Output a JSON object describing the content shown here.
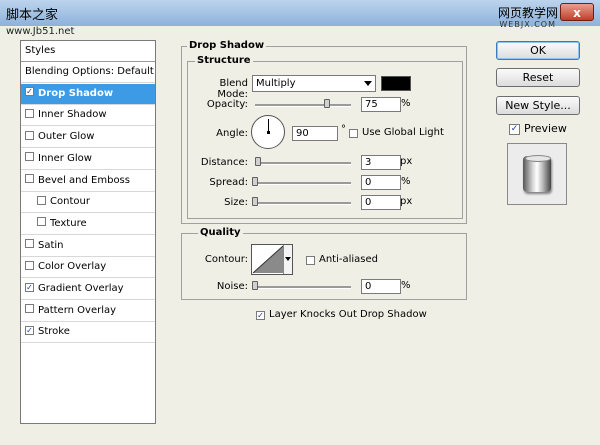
{
  "titlebar": {
    "wm_left": "脚本之家",
    "wm_left2": "www.Jb51.net",
    "wm_right": "网页教学网",
    "wm_right2": "WEBJX.COM",
    "close_label": "x"
  },
  "styles_list": {
    "header": "Styles",
    "items": [
      {
        "label": "Blending Options: Default",
        "checkbox": false,
        "checked": false,
        "selected": false,
        "indent": false
      },
      {
        "label": "Drop Shadow",
        "checkbox": true,
        "checked": true,
        "selected": true,
        "indent": false
      },
      {
        "label": "Inner Shadow",
        "checkbox": true,
        "checked": false,
        "selected": false,
        "indent": false
      },
      {
        "label": "Outer Glow",
        "checkbox": true,
        "checked": false,
        "selected": false,
        "indent": false
      },
      {
        "label": "Inner Glow",
        "checkbox": true,
        "checked": false,
        "selected": false,
        "indent": false
      },
      {
        "label": "Bevel and Emboss",
        "checkbox": true,
        "checked": false,
        "selected": false,
        "indent": false
      },
      {
        "label": "Contour",
        "checkbox": true,
        "checked": false,
        "selected": false,
        "indent": true
      },
      {
        "label": "Texture",
        "checkbox": true,
        "checked": false,
        "selected": false,
        "indent": true
      },
      {
        "label": "Satin",
        "checkbox": true,
        "checked": false,
        "selected": false,
        "indent": false
      },
      {
        "label": "Color Overlay",
        "checkbox": true,
        "checked": false,
        "selected": false,
        "indent": false
      },
      {
        "label": "Gradient Overlay",
        "checkbox": true,
        "checked": true,
        "selected": false,
        "indent": false
      },
      {
        "label": "Pattern Overlay",
        "checkbox": true,
        "checked": false,
        "selected": false,
        "indent": false
      },
      {
        "label": "Stroke",
        "checkbox": true,
        "checked": true,
        "selected": false,
        "indent": false
      }
    ]
  },
  "drop_shadow": {
    "title": "Drop Shadow",
    "structure": {
      "title": "Structure",
      "blend_mode_label": "Blend Mode:",
      "blend_mode_value": "Multiply",
      "shadow_color": "#000000",
      "opacity_label": "Opacity:",
      "opacity_value": "75",
      "opacity_unit": "%",
      "angle_label": "Angle:",
      "angle_value": "90",
      "angle_unit": "°",
      "global_light_label": "Use Global Light",
      "global_light_checked": false,
      "distance_label": "Distance:",
      "distance_value": "3",
      "distance_unit": "px",
      "spread_label": "Spread:",
      "spread_value": "0",
      "spread_unit": "%",
      "size_label": "Size:",
      "size_value": "0",
      "size_unit": "px"
    },
    "quality": {
      "title": "Quality",
      "contour_label": "Contour:",
      "anti_aliased_label": "Anti-aliased",
      "anti_aliased_checked": false,
      "noise_label": "Noise:",
      "noise_value": "0",
      "noise_unit": "%"
    },
    "knockout_label": "Layer Knocks Out Drop Shadow",
    "knockout_checked": true
  },
  "buttons": {
    "ok": "OK",
    "reset": "Reset",
    "new_style": "New Style...",
    "preview_label": "Preview",
    "preview_checked": true
  },
  "colors": {
    "selected_row": "#3d9be6",
    "dialog_bg": "#f0efe6"
  }
}
